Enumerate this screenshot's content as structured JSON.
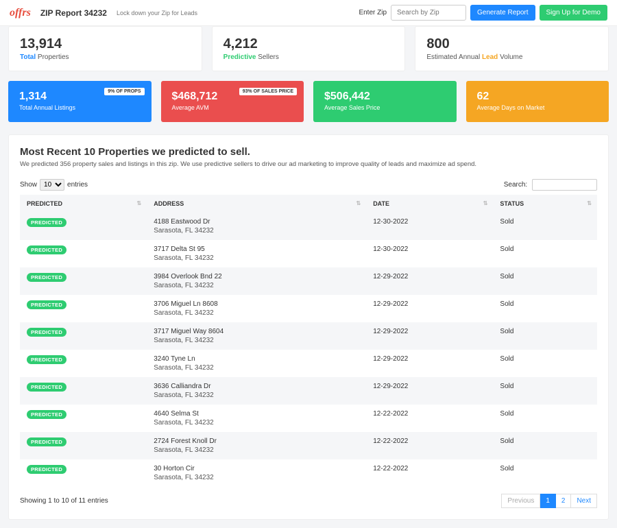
{
  "header": {
    "logo": "offrs",
    "title": "ZIP Report 34232",
    "tagline": "Lock down your Zip for Leads",
    "enter_zip_label": "Enter Zip",
    "zip_placeholder": "Search by Zip",
    "generate_btn": "Generate Report",
    "signup_btn": "Sign Up for Demo"
  },
  "kpis": [
    {
      "value": "13,914",
      "pre": "Total",
      "post": " Properties",
      "hl": "blue"
    },
    {
      "value": "4,212",
      "pre": "Predictive",
      "post": " Sellers",
      "hl": "green"
    },
    {
      "value": "800",
      "pre": "Estimated Annual ",
      "mid": "Lead",
      "post": " Volume",
      "hl": "orange"
    }
  ],
  "stats": [
    {
      "value": "1,314",
      "label": "Total Annual Listings",
      "badge": "9% OF PROPS",
      "color": "blue"
    },
    {
      "value": "$468,712",
      "label": "Average AVM",
      "badge": "93% OF SALES PRICE",
      "color": "red"
    },
    {
      "value": "$506,442",
      "label": "Average Sales Price",
      "badge": "",
      "color": "green"
    },
    {
      "value": "62",
      "label": "Average Days on Market",
      "badge": "",
      "color": "orange"
    }
  ],
  "panel": {
    "title": "Most Recent 10 Properties we predicted to sell.",
    "subtitle": "We predicted 356 property sales and listings in this zip. We use predictive sellers to drive our ad marketing to improve quality of leads and maximize ad spend."
  },
  "table_controls": {
    "show_label": "Show",
    "entries_label": "entries",
    "length_value": "10",
    "search_label": "Search:"
  },
  "columns": [
    "PREDICTED",
    "ADDRESS",
    "DATE",
    "STATUS"
  ],
  "rows": [
    {
      "predicted": "PREDICTED",
      "addr1": "4188 Eastwood Dr",
      "addr2": "Sarasota, FL 34232",
      "date": "12-30-2022",
      "status": "Sold"
    },
    {
      "predicted": "PREDICTED",
      "addr1": "3717 Delta St 95",
      "addr2": "Sarasota, FL 34232",
      "date": "12-30-2022",
      "status": "Sold"
    },
    {
      "predicted": "PREDICTED",
      "addr1": "3984 Overlook Bnd 22",
      "addr2": "Sarasota, FL 34232",
      "date": "12-29-2022",
      "status": "Sold"
    },
    {
      "predicted": "PREDICTED",
      "addr1": "3706 Miguel Ln 8608",
      "addr2": "Sarasota, FL 34232",
      "date": "12-29-2022",
      "status": "Sold"
    },
    {
      "predicted": "PREDICTED",
      "addr1": "3717 Miguel Way 8604",
      "addr2": "Sarasota, FL 34232",
      "date": "12-29-2022",
      "status": "Sold"
    },
    {
      "predicted": "PREDICTED",
      "addr1": "3240 Tyne Ln",
      "addr2": "Sarasota, FL 34232",
      "date": "12-29-2022",
      "status": "Sold"
    },
    {
      "predicted": "PREDICTED",
      "addr1": "3636 Calliandra Dr",
      "addr2": "Sarasota, FL 34232",
      "date": "12-29-2022",
      "status": "Sold"
    },
    {
      "predicted": "PREDICTED",
      "addr1": "4640 Selma St",
      "addr2": "Sarasota, FL 34232",
      "date": "12-22-2022",
      "status": "Sold"
    },
    {
      "predicted": "PREDICTED",
      "addr1": "2724 Forest Knoll Dr",
      "addr2": "Sarasota, FL 34232",
      "date": "12-22-2022",
      "status": "Sold"
    },
    {
      "predicted": "PREDICTED",
      "addr1": "30 Horton Cir",
      "addr2": "Sarasota, FL 34232",
      "date": "12-22-2022",
      "status": "Sold"
    }
  ],
  "footer": {
    "info": "Showing 1 to 10 of 11 entries",
    "pages": [
      "Previous",
      "1",
      "2",
      "Next"
    ],
    "active_index": 1
  }
}
